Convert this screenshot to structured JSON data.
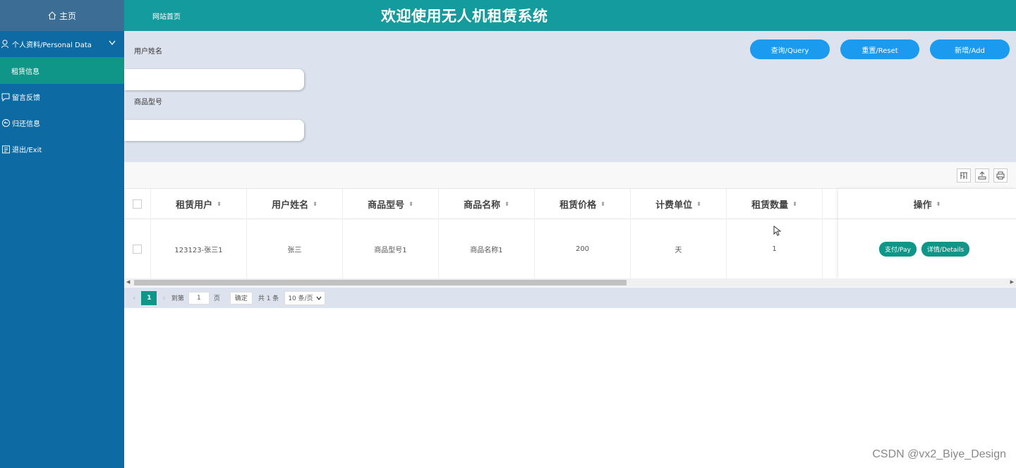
{
  "sidebar": {
    "home": "主页",
    "personal": "个人资料/Personal Data",
    "rental": "租赁信息",
    "feedback": "留言反馈",
    "returns": "归还信息",
    "exit": "退出/Exit"
  },
  "header": {
    "site_link": "网站首页",
    "title": "欢迎使用无人机租赁系统"
  },
  "search": {
    "label_name": "用户姓名",
    "label_model": "商品型号",
    "query": "查询/Query",
    "reset": "重置/Reset",
    "add": "新增/Add"
  },
  "table": {
    "columns": [
      "租赁用户",
      "用户姓名",
      "商品型号",
      "商品名称",
      "租赁价格",
      "计费单位",
      "租赁数量"
    ],
    "ops_header": "操作",
    "rows": [
      {
        "cells": [
          "123123-张三1",
          "张三",
          "商品型号1",
          "商品名称1",
          "200",
          "天",
          "1"
        ],
        "pay": "支付/Pay",
        "details": "详情/Details"
      }
    ]
  },
  "pager": {
    "current": "1",
    "goto_prefix": "到第",
    "goto_value": "1",
    "goto_suffix": "页",
    "confirm": "确定",
    "total": "共 1 条",
    "page_size": "10 条/页"
  },
  "watermark": "CSDN @vx2_Biye_Design"
}
